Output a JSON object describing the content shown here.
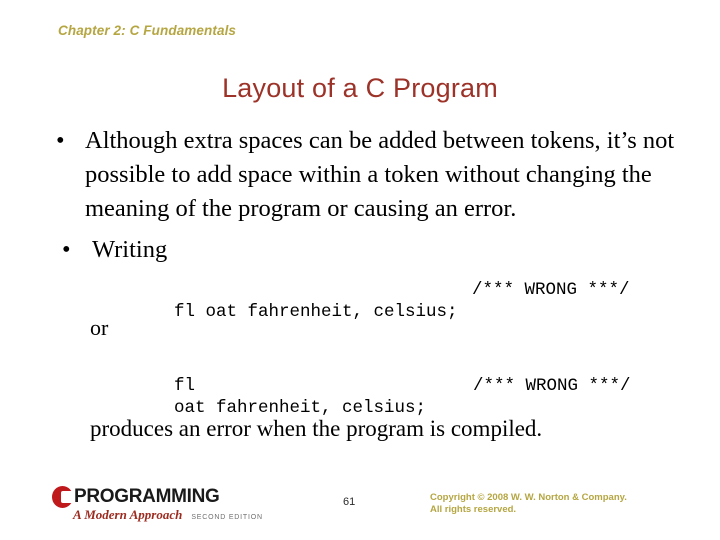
{
  "slide": {
    "chapter_header": "Chapter 2: C Fundamentals",
    "title": "Layout of a C Program",
    "bullets": [
      {
        "marker": "•",
        "text": "Although extra spaces can be added between tokens, it’s not possible to add space within a token without changing the meaning of the program or causing an error."
      },
      {
        "marker": "•",
        "text": "Writing"
      }
    ],
    "code_block_1": {
      "code": "fl oat fahrenheit, celsius;",
      "comment": "/*** WRONG ***/"
    },
    "connector": "or",
    "code_block_2": {
      "code_line_1": "fl",
      "code_line_2": "oat fahrenheit, celsius;",
      "comment": "/*** WRONG ***/"
    },
    "closing_text": "produces an error when the program is compiled."
  },
  "footer": {
    "logo": {
      "mark": "C",
      "word": "PROGRAMMING",
      "subtitle": "A Modern Approach",
      "edition": "Second Edition"
    },
    "page_number": "61",
    "copyright_line_1": "Copyright © 2008 W. W. Norton & Company.",
    "copyright_line_2": "All rights reserved."
  },
  "colors": {
    "title": "#9c3228",
    "chapter_header": "#b5a642",
    "copyright": "#b5a642",
    "logo_mark": "#c0191c",
    "logo_subtitle": "#9c2b20",
    "body_text": "#000000",
    "background": "#ffffff"
  }
}
